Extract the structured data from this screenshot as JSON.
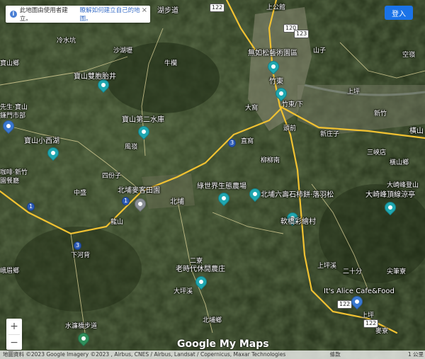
{
  "banner": {
    "text": "此地圖由使用者建立。",
    "link": "瞭解如何建立自己的地圖。",
    "close": "×"
  },
  "login_label": "登入",
  "zoom": {
    "in": "+",
    "out": "−"
  },
  "brand": "Google My Maps",
  "footer": {
    "attribution": "地圖資料 ©2023 Google Imagery ©2023 , Airbus, CNES / Airbus, Landsat / Copernicus, Maxar Technologies",
    "terms": "條款",
    "scale": "1 公里"
  },
  "labels": {
    "hsinchu_trail": "湖步道",
    "shang_gong_ji": "上公館",
    "shanmingxinhu": "沙湖壢",
    "gemu": "牛欄",
    "baoshan_township": "寶山鄉",
    "baoshan_shuangtai": "寶山雙胞胎井",
    "lingshui_keng": "冷水坑",
    "emei_art": "無如松藝術園區",
    "zhudong": "竹東",
    "shanzi": "山子",
    "xiang": "上坪",
    "dahe": "大窩",
    "zhudong_sub": "竹東/下",
    "shuibei": "新庄子",
    "xinzhu": "新竹",
    "weipo": "頭前",
    "xintun_sub": "三峽店",
    "hengshan": "橫山",
    "hengshan_township": "橫山鄉",
    "kong_sub": "空嶺",
    "baoshan_reservoir2": "寶山第二水庫",
    "fengqi": "風嶺",
    "zhiliao": "直窩",
    "liuliukeng": "柳柳南",
    "baoshan_xihu": "寶山小西湖",
    "mr_baoshan": "先生·寶山\n鎌門市部",
    "coffee": "咖啡·新竹\n園餐廳",
    "sifenzi": "四份子",
    "zhongsheng": "中盛",
    "beipu_farm": "北埔麥客田園",
    "beipu": "北埔",
    "green_farm": "綠世界生態農場",
    "beipu_liuju": "北埔六壽石柿餅·落羽松",
    "daqi_lodge": "大崎峰頂線涼亭",
    "daqi_mountain": "大崎峰登山",
    "liushan": "龍山",
    "xiaheji": "下河背",
    "juqiao": "軟橋彩繪村",
    "emei_township": "峨眉鄉",
    "old_farm": "老時代休閒農庄",
    "erchong": "二寮",
    "shangping": "上坪溪",
    "ershifen": "二十分",
    "wuweiping": "尖筆寮",
    "alice": "It's Alice Cafe&Food",
    "beipu_township": "北埔鄉",
    "shuilian_trail": "水濂橋步道",
    "lingping": "上坪",
    "shaoxing": "麥寮",
    "dawo": "大坪溪"
  },
  "shields": [
    "122",
    "120",
    "123",
    "3",
    "1",
    "3",
    "122",
    "122",
    "1"
  ],
  "colors": {
    "road_major": "#f1c232",
    "road_minor": "#e8dca0",
    "login": "#1a73e8",
    "pin_teal": "#1fa7b0"
  }
}
